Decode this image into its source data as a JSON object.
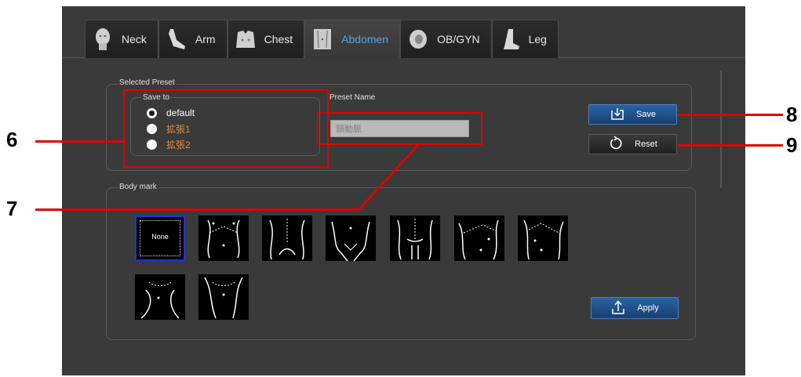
{
  "tabs": [
    {
      "label": "Neck",
      "icon": "neck-icon",
      "active": false
    },
    {
      "label": "Arm",
      "icon": "arm-icon",
      "active": false
    },
    {
      "label": "Chest",
      "icon": "chest-icon",
      "active": false
    },
    {
      "label": "Abdomen",
      "icon": "abdomen-icon",
      "active": true
    },
    {
      "label": "OB/GYN",
      "icon": "obgyn-icon",
      "active": false
    },
    {
      "label": "Leg",
      "icon": "leg-icon",
      "active": false
    }
  ],
  "selected_preset": {
    "title": "Selected Preset",
    "save_to": {
      "title": "Save to",
      "options": [
        {
          "label": "default",
          "checked": true,
          "color": "#ffffff"
        },
        {
          "label": "拡張1",
          "checked": false,
          "color": "#e0894a"
        },
        {
          "label": "拡張2",
          "checked": false,
          "color": "#e0894a"
        }
      ]
    },
    "preset_name": {
      "title": "Preset Name",
      "value": "頸動脈"
    },
    "save_label": "Save",
    "reset_label": "Reset"
  },
  "body_mark": {
    "title": "Body mark",
    "thumbnails": [
      {
        "label": "None",
        "selected": true
      },
      {
        "label": "",
        "selected": false
      },
      {
        "label": "",
        "selected": false
      },
      {
        "label": "",
        "selected": false
      },
      {
        "label": "",
        "selected": false
      },
      {
        "label": "",
        "selected": false
      },
      {
        "label": "",
        "selected": false
      },
      {
        "label": "",
        "selected": false
      },
      {
        "label": "",
        "selected": false
      }
    ],
    "apply_label": "Apply"
  },
  "callouts": {
    "six": "6",
    "seven": "7",
    "eight": "8",
    "nine": "9"
  },
  "colors": {
    "accent": "#4aa8e8",
    "callout": "#e00000",
    "button_blue": "#1d4f86",
    "selection_border": "#2233cc"
  }
}
